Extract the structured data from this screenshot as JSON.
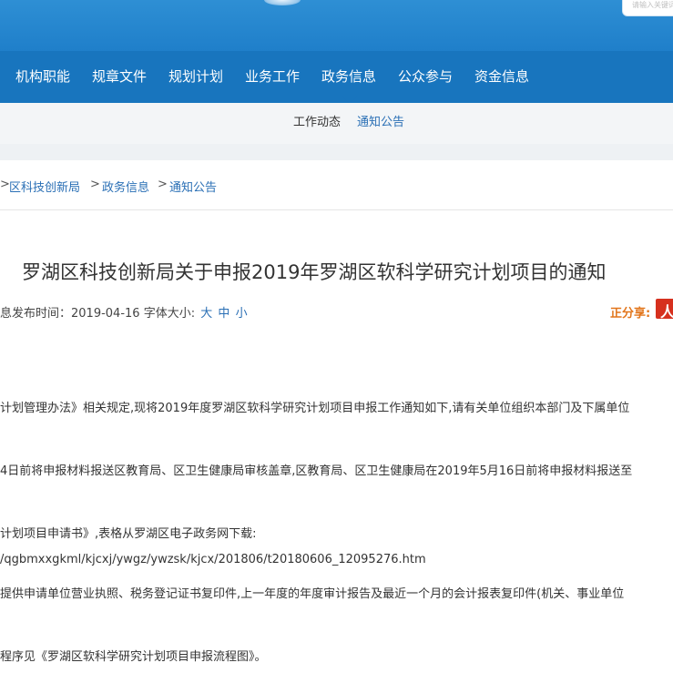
{
  "header": {
    "search_placeholder": "请输入关键词"
  },
  "nav": {
    "items": [
      "机构职能",
      "规章文件",
      "规划计划",
      "业务工作",
      "政务信息",
      "公众参与",
      "资金信息"
    ]
  },
  "subnav": {
    "items": [
      "工作动态",
      "通知公告"
    ],
    "active": "通知公告"
  },
  "breadcrumb": {
    "items": [
      "区科技创新局",
      "政务信息",
      "通知公告"
    ],
    "separator": ">"
  },
  "article": {
    "title": "罗湖区科技创新局关于申报2019年罗湖区软科学研究计划项目的通知",
    "meta_prefix": "息发布时间：",
    "date": "2019-04-16",
    "font_label": "字体大小:",
    "sizes": [
      "大",
      "中",
      "小"
    ],
    "share_label": "正分享:",
    "paragraphs": [
      "计划管理办法》相关规定,现将2019年度罗湖区软科学研究计划项目申报工作通知如下,请有关单位组织本部门及下属单位",
      "4日前将申报材料报送区教育局、区卫生健康局审核盖章,区教育局、区卫生健康局在2019年5月16日前将申报材料报送至",
      "计划项目申请书》,表格从罗湖区电子政务网下载:",
      "/qgbmxxgkml/kjcxj/ywgz/ywzsk/kjcx/201806/t20180606_12095276.htm",
      "提供申请单位营业执照、税务登记证书复印件,上一年度的年度审计报告及最近一个月的会计报表复印件(机关、事业单位",
      "程序见《罗湖区软科学研究计划项目申报流程图》。"
    ]
  },
  "colors": {
    "nav_bg": "#1875be",
    "banner": "#2e8fd4",
    "link": "#2a6fb5",
    "share": "#e2761c"
  }
}
